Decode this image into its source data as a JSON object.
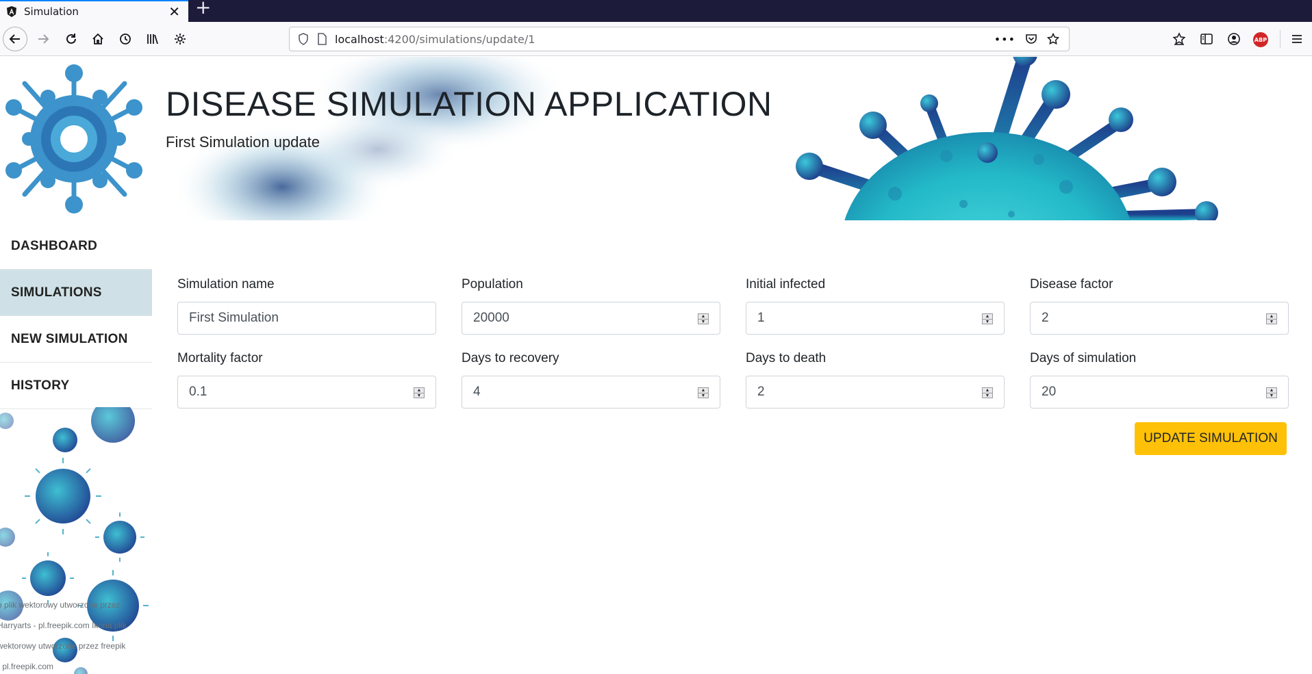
{
  "browser": {
    "tab_title": "Simulation",
    "new_tab_symbol": "+",
    "url_host": "localhost",
    "url_path": ":4200/simulations/update/1",
    "url_more": "•••",
    "abp_label": "ABP",
    "icons": [
      "back-icon",
      "forward-icon",
      "reload-icon",
      "home-icon",
      "history-icon",
      "library-icon",
      "settings-icon",
      "site-info-icon",
      "page-icon",
      "pocket-icon",
      "bookmark-star-icon",
      "reading-list-icon",
      "sidebar-icon",
      "account-icon",
      "adblock-icon",
      "menu-icon"
    ]
  },
  "sidebar": {
    "items": [
      {
        "label": "DASHBOARD"
      },
      {
        "label": "SIMULATIONS"
      },
      {
        "label": "NEW SIMULATION"
      },
      {
        "label": "HISTORY"
      }
    ],
    "active_index": 1,
    "credit_lines": [
      "o plik wektorowy utworzone przez",
      "Harryarts - pl.freepik.com Ikona plik",
      "wektorowy utworzone przez freepik",
      "- pl.freepik.com"
    ]
  },
  "header": {
    "title": "DISEASE SIMULATION APPLICATION",
    "subtitle": "First Simulation update"
  },
  "form": {
    "fields": [
      {
        "label": "Simulation name",
        "value": "First Simulation",
        "type": "text"
      },
      {
        "label": "Population",
        "value": "20000",
        "type": "number"
      },
      {
        "label": "Initial infected",
        "value": "1",
        "type": "number"
      },
      {
        "label": "Disease factor",
        "value": "2",
        "type": "number"
      },
      {
        "label": "Mortality factor",
        "value": "0.1",
        "type": "number"
      },
      {
        "label": "Days to recovery",
        "value": "4",
        "type": "number"
      },
      {
        "label": "Days to death",
        "value": "2",
        "type": "number"
      },
      {
        "label": "Days of simulation",
        "value": "20",
        "type": "number"
      }
    ],
    "submit_label": "UPDATE SIMULATION"
  },
  "colors": {
    "accent": "#ffc107",
    "active_nav": "#cfe1e6",
    "virus_teal": "#29b6c8",
    "virus_blue": "#2f8fcf",
    "virus_dark": "#1f3f8f"
  }
}
